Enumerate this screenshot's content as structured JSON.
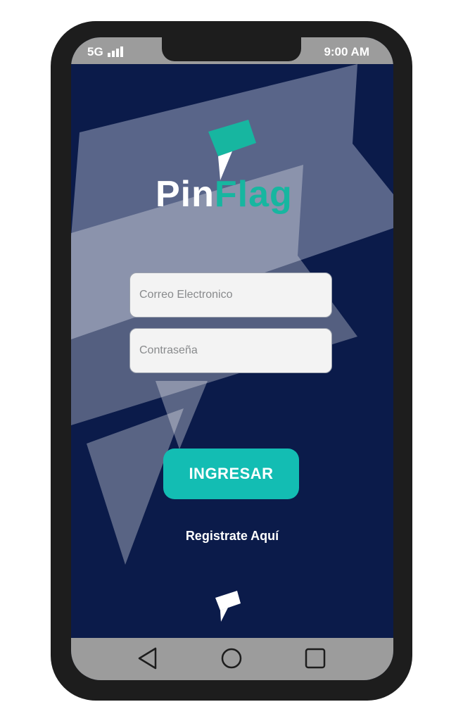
{
  "status_bar": {
    "network": "5G",
    "time": "9:00 AM"
  },
  "logo": {
    "word_part1": "Pin",
    "word_part2": "Flag",
    "flag_color": "#17b6a0"
  },
  "form": {
    "email_placeholder": "Correo Electronico",
    "password_placeholder": "Contraseña",
    "submit_label": "INGRESAR",
    "register_link": "Registrate Aquí"
  },
  "nav_bar": {
    "icons": [
      "back-triangle-icon",
      "home-circle-icon",
      "recents-square-icon"
    ]
  },
  "colors": {
    "background": "#0b1b4a",
    "accent": "#13bdb3",
    "bars": "#9c9c9c"
  }
}
